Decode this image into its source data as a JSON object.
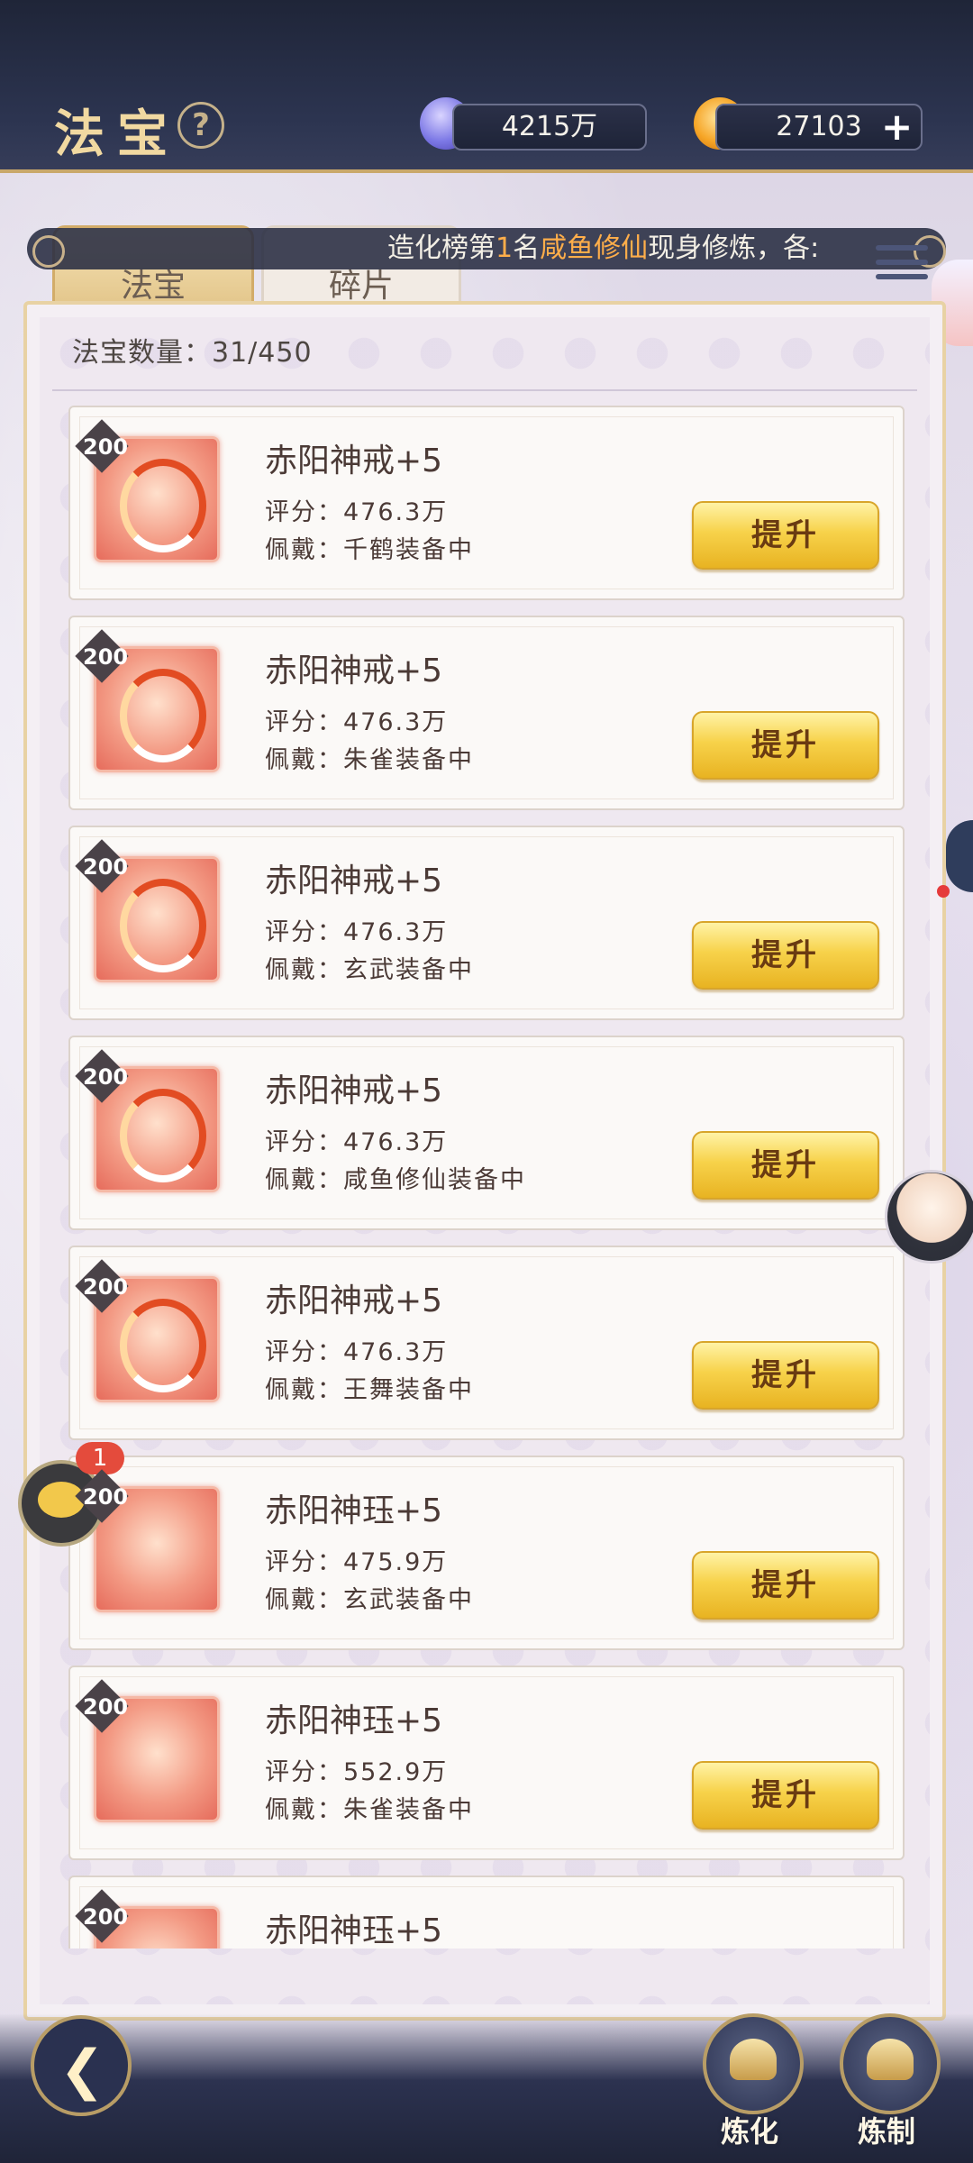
{
  "header": {
    "title": "法宝",
    "help_icon": "?",
    "resource1": {
      "icon": "jade-gem-icon",
      "value": "4215万"
    },
    "resource2": {
      "icon": "flame-icon",
      "value": "27103",
      "add": "+"
    }
  },
  "ticker": {
    "prefix": "造化榜第",
    "rank": "1",
    "mid": "名",
    "highlight": "咸鱼修仙",
    "suffix": "现身修炼，各:"
  },
  "tabs": [
    {
      "label": "法宝",
      "active": true
    },
    {
      "label": "碎片",
      "active": false
    }
  ],
  "count_text": "法宝数量：31/450",
  "items": [
    {
      "level": "200",
      "name": "赤阳神戒+5",
      "score": "评分：476.3万",
      "equip": "佩戴：千鹤装备中",
      "button": "提升"
    },
    {
      "level": "200",
      "name": "赤阳神戒+5",
      "score": "评分：476.3万",
      "equip": "佩戴：朱雀装备中",
      "button": "提升"
    },
    {
      "level": "200",
      "name": "赤阳神戒+5",
      "score": "评分：476.3万",
      "equip": "佩戴：玄武装备中",
      "button": "提升"
    },
    {
      "level": "200",
      "name": "赤阳神戒+5",
      "score": "评分：476.3万",
      "equip": "佩戴：咸鱼修仙装备中",
      "button": "提升"
    },
    {
      "level": "200",
      "name": "赤阳神戒+5",
      "score": "评分：476.3万",
      "equip": "佩戴：王舞装备中",
      "button": "提升"
    },
    {
      "level": "200",
      "name": "赤阳神珏+5",
      "score": "评分：475.9万",
      "equip": "佩戴：玄武装备中",
      "button": "提升"
    },
    {
      "level": "200",
      "name": "赤阳神珏+5",
      "score": "评分：552.9万",
      "equip": "佩戴：朱雀装备中",
      "button": "提升"
    },
    {
      "level": "200",
      "name": "赤阳神珏+5",
      "score": "",
      "equip": "",
      "button": ""
    }
  ],
  "chat": {
    "badge": "1"
  },
  "bottom": {
    "refine_label": "炼化",
    "craft_label": "炼制"
  },
  "colors": {
    "accent_gold": "#f1d9a1",
    "ticker_highlight": "#ffae4a",
    "button_gold": "#f7d24a"
  }
}
